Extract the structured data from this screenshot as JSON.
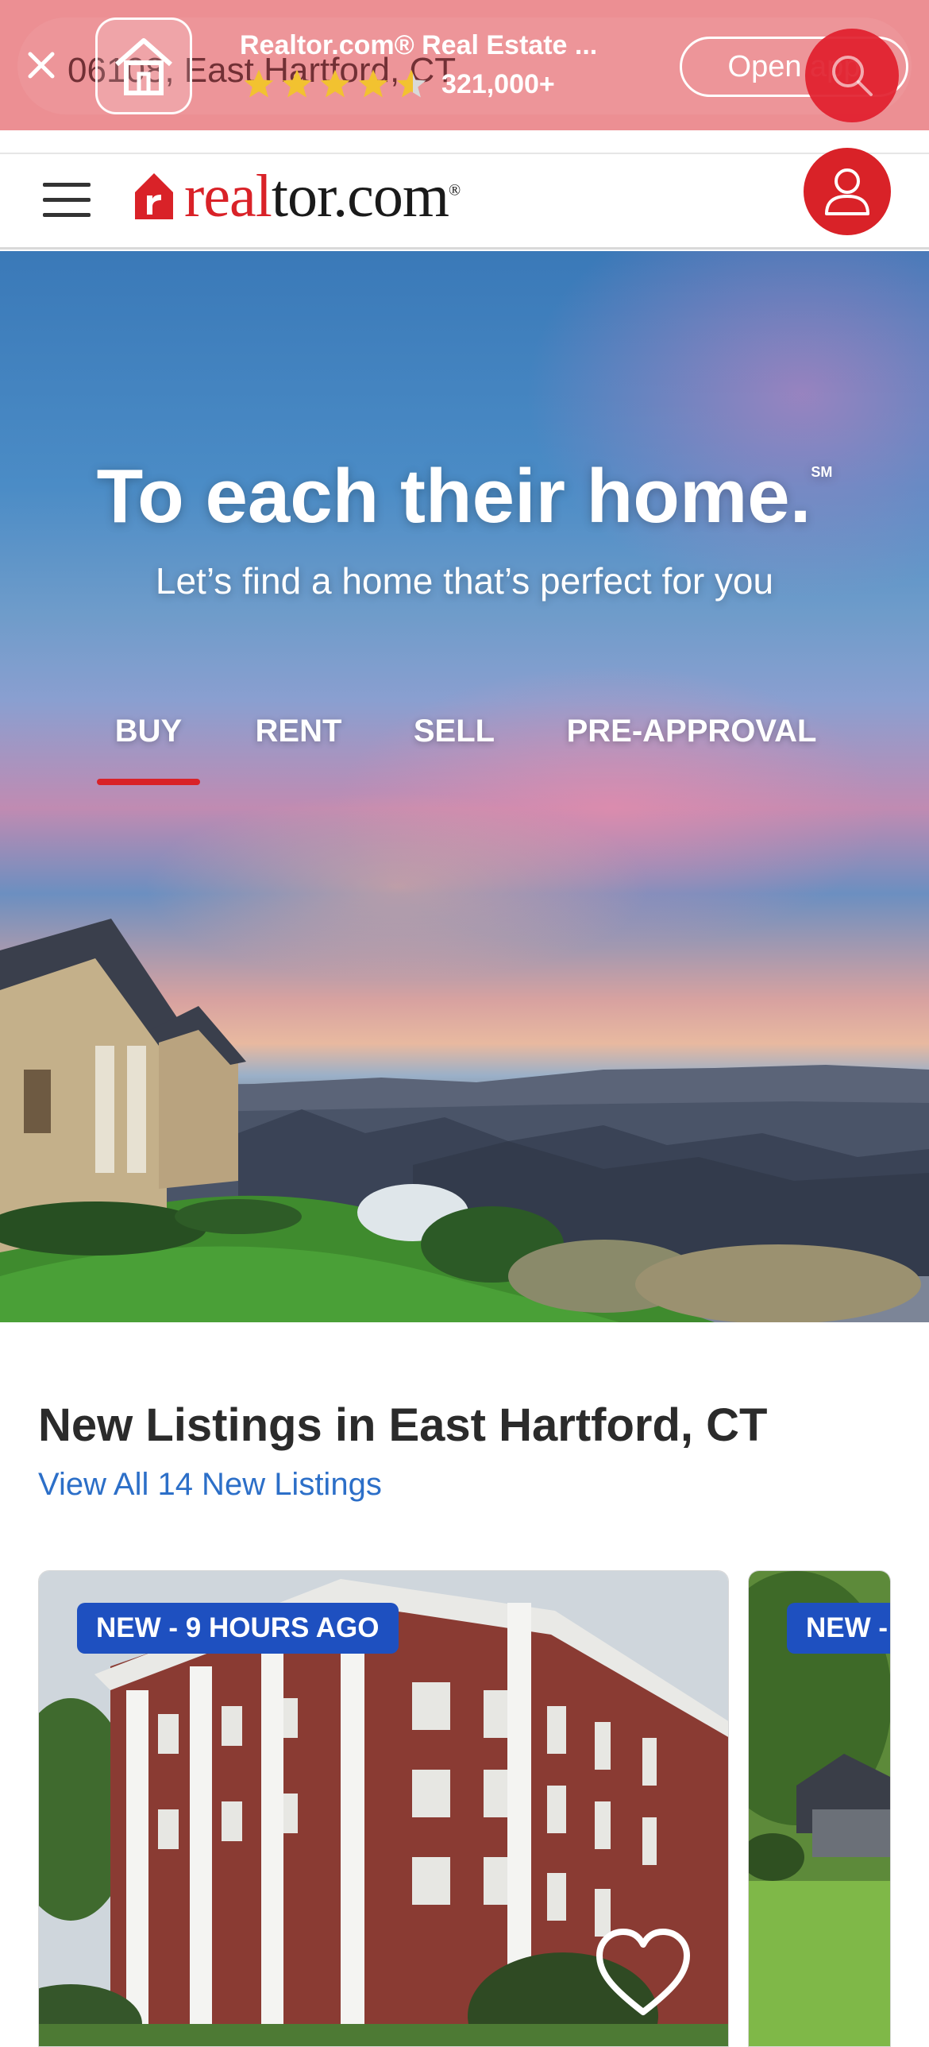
{
  "app_banner": {
    "search_bg_text": "06108, East Hartford, CT",
    "title": "Realtor.com® Real Estate ...",
    "rating_count": "321,000+",
    "open_button": "Open app"
  },
  "header": {
    "logo_part_1": "real",
    "logo_part_2": "tor.com",
    "logo_registered": "®"
  },
  "hero": {
    "title": "To each their home.",
    "title_mark": "SM",
    "subtitle": "Let’s find a home that’s perfect for you",
    "tabs": [
      {
        "label": "BUY",
        "active": true
      },
      {
        "label": "RENT",
        "active": false
      },
      {
        "label": "SELL",
        "active": false
      },
      {
        "label": "PRE-APPROVAL",
        "active": false
      }
    ]
  },
  "new_listings": {
    "title": "New Listings in East Hartford, CT",
    "view_all_link": "View All 14 New Listings",
    "cards": [
      {
        "badge": "NEW - 9 HOURS AGO"
      },
      {
        "badge": "NEW -"
      }
    ]
  },
  "colors": {
    "brand_red": "#d92228",
    "link_blue": "#2c6fc8",
    "badge_blue": "#1e50c0",
    "banner_pink": "#ec8f93"
  }
}
